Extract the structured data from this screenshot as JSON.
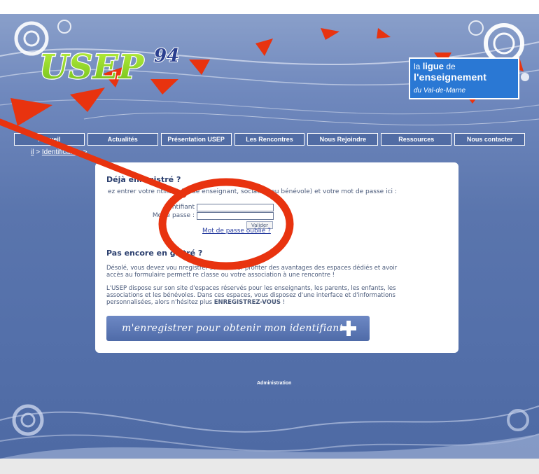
{
  "logos": {
    "usep_text": "USEP",
    "usep_number": "94",
    "ligue_line1_prefix": "la",
    "ligue_line1_bold": "ligue",
    "ligue_line1_suffix": "de",
    "ligue_line2": "l'enseignement",
    "ligue_line3": "du Val-de-Marne"
  },
  "nav": {
    "items": [
      {
        "label": "Accueil"
      },
      {
        "label": "Actualités"
      },
      {
        "label": "Présentation USEP"
      },
      {
        "label": "Les Rencontres"
      },
      {
        "label": "Nous Rejoindre"
      },
      {
        "label": "Ressources"
      },
      {
        "label": "Nous contacter"
      }
    ]
  },
  "breadcrumb": {
    "part1": "il",
    "sep1": " > ",
    "part2": "Identification",
    "sep2": " >"
  },
  "login": {
    "heading": "Déjà enregistré ?",
    "intro": "ez entrer votre   ntifiant (Code enseignant,   sociation ou bénévole) et votre mot de passe ici :",
    "id_label": "ntifiant",
    "password_label": "Mot  e passe :",
    "validate_label": "Valider",
    "forgot_link": "Mot de passe oublié ?"
  },
  "register": {
    "heading": "Pas encore en   gistré ?",
    "para1_line1": "Désolé, vous devez vou   nregistrer sur le s   our profiter des avantages des espaces dédiés et avoir",
    "para1_line2": "accès au formulaire permett                     re classe ou votre association à une rencontre !",
    "para2_line1": "L'USEP dispose sur son site d'espaces réservés pour les enseignants, les parents, les enfants, les",
    "para2_line2": "associations et les bénévoles. Dans ces espaces, vous disposez d'une interface et d'informations",
    "para2_line3_prefix": "personnalisées, alors n'hésitez plus ",
    "para2_line3_bold": "ENREGISTREZ-VOUS",
    "para2_line3_suffix": " !",
    "button_label": "m'enregistrer pour obtenir mon identifiant"
  },
  "footer": {
    "admin": "Administration"
  },
  "colors": {
    "background": "#5a75ad",
    "annotation": "#e8330f",
    "ligue_box": "#2a78d4",
    "heading": "#2b3f6e"
  },
  "icons": {
    "register_button": "plus-icon"
  }
}
